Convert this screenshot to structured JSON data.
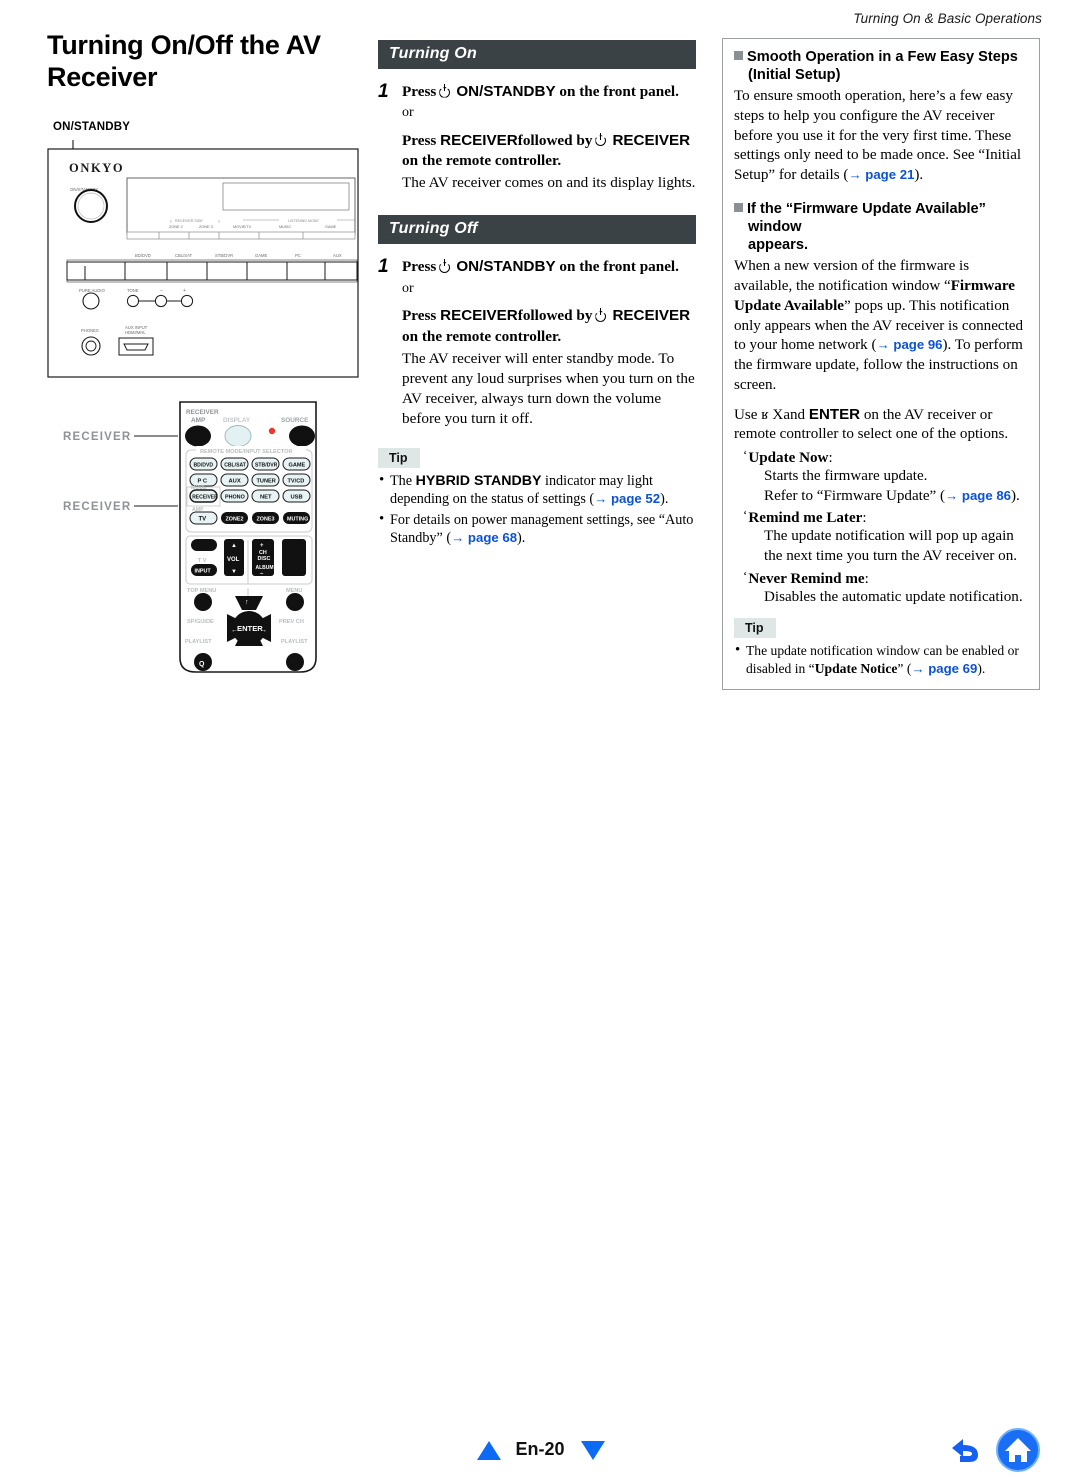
{
  "header": {
    "running_title": "Turning On & Basic Operations"
  },
  "left": {
    "chapter_title": "Turning On/Off the AV Receiver",
    "callout_onstandby": "ON/STANDBY",
    "receiver_figure": {
      "brand": "ONKYO",
      "power_label": "ON/STANDBY",
      "listening_mode_group": "LISTENING MODE",
      "listening_modes": [
        "MOVIE/TV",
        "MUSIC",
        "GAME"
      ],
      "zone_group": "RECEIVER SIDE",
      "zones": [
        "ZONE 2",
        "ZONE 3"
      ],
      "input_labels": [
        "BD/DVD",
        "CBL/SAT",
        "STB/DVR",
        "GAME",
        "PC",
        "AUX"
      ],
      "knob_labels": [
        "PURE AUDIO",
        "TONE",
        "–",
        "+"
      ],
      "jack_labels": [
        "PHONES",
        "AUX INPUT HDMI/MHL"
      ]
    },
    "remote_figure": {
      "callout_top": "RECEIVER",
      "callout_bottom": "RECEIVER",
      "top_labels": [
        "RECEIVER AMP",
        "DISPLAY",
        "SOURCE"
      ],
      "selector_group": "REMOTE MODE/INPUT SELECTOR",
      "selector_buttons": [
        "BD/DVD",
        "CBL/SAT",
        "STB/DVR",
        "GAME",
        "P C",
        "AUX",
        "TUNER",
        "TV/CD",
        "RECEIVER",
        "PHONO",
        "NET",
        "USB",
        "TV",
        "ZONE2",
        "ZONE3",
        "MUTING"
      ],
      "mode_label": "MODE",
      "amp_label": "AMP",
      "mid_labels": [
        "TV",
        "INPUT",
        "VOL",
        "+",
        "CH",
        "DISC",
        "ALBUM",
        "–"
      ],
      "lower_labels": [
        "TOP MENU",
        "MENU",
        "SP/GUIDE",
        "PREV CH",
        "PLAYLIST",
        "PLAYLIST",
        "ENTER",
        "Q"
      ]
    }
  },
  "middle": {
    "sections": [
      {
        "title": "Turning On",
        "step_number": "1",
        "step_line_1_pre": "Press",
        "step_line_1_bold": "ON/STANDBY",
        "step_line_1_post": "on the front panel.",
        "or": "or",
        "step_line_2_pre": "Press",
        "step_line_2_bold_a": "RECEIVER",
        "step_line_2_mid": "followed by",
        "step_line_2_bold_b": "RECEIVER",
        "step_line_2_post": "on the remote controller.",
        "description": "The AV receiver comes on and its display lights."
      },
      {
        "title": "Turning Off",
        "step_number": "1",
        "step_line_1_pre": "Press",
        "step_line_1_bold": "ON/STANDBY",
        "step_line_1_post": "on the front panel.",
        "or": "or",
        "step_line_2_pre": "Press",
        "step_line_2_bold_a": "RECEIVER",
        "step_line_2_mid": "followed by",
        "step_line_2_bold_b": "RECEIVER",
        "step_line_2_post": "on the remote controller.",
        "description": "The AV receiver will enter standby mode. To prevent any loud surprises when you turn on the AV receiver, always turn down the volume before you turn it off."
      }
    ],
    "tip": {
      "label": "Tip",
      "items": [
        {
          "pre": "The ",
          "bold": "HYBRID STANDBY",
          "mid": " indicator may light depending on the status of settings (",
          "ref": "→ page 52",
          "post": ")."
        },
        {
          "pre": "For details on power management settings, see “Auto Standby” (",
          "bold": "",
          "mid": "",
          "ref": "→ page 68",
          "post": ")."
        }
      ]
    }
  },
  "right": {
    "head1_line1": "Smooth Operation in a Few Easy Steps",
    "head1_line2": "(Initial Setup)",
    "para1_a": "To ensure smooth operation, here’s a few easy steps to help you configure the AV receiver before you use it for the very first time. These settings only need to be made once. See “Initial Setup” for details (",
    "para1_ref": "→ page 21",
    "para1_b": ").",
    "head2_line1": "If the “Firmware Update Available” window",
    "head2_line2": "appears.",
    "para2_a": "When a new version of the firmware is available, the notification window “",
    "para2_bold": "Firmware Update Available",
    "para2_b": "” pops up. This notification only appears when the AV receiver is connected to your home network (",
    "para2_ref": "→ page 96",
    "para2_c": "). To perform the firmware update, follow the instructions on screen.",
    "para3_a": "Use",
    "para3_glyph": "ʁ X",
    "para3_b": "and",
    "para3_bold": "ENTER",
    "para3_c": "on the AV receiver or remote controller to select one of the options.",
    "options": [
      {
        "term": "Update Now",
        "term_suffix": ":",
        "def_line1": "Starts the firmware update.",
        "def_line2_a": "Refer to “Firmware Update” (",
        "def_line2_ref": "→ page 86",
        "def_line2_b": ")."
      },
      {
        "term": "Remind me Later",
        "term_suffix": ":",
        "def_line1": "The update notification will pop up again the next time you turn the AV receiver on.",
        "def_line2_a": "",
        "def_line2_ref": "",
        "def_line2_b": ""
      },
      {
        "term": "Never Remind me",
        "term_suffix": ":",
        "def_line1": "Disables the automatic update notification.",
        "def_line2_a": "",
        "def_line2_ref": "",
        "def_line2_b": ""
      }
    ],
    "tip": {
      "label": "Tip",
      "item_pre": "The update notification window can be enabled or disabled in “",
      "item_bold": "Update Notice",
      "item_mid": "” (",
      "item_ref": "→ page 69",
      "item_post": ")."
    }
  },
  "footer": {
    "page_label": "En-20",
    "prev_icon": "triangle-up-icon",
    "next_icon": "triangle-down-icon",
    "back_icon": "back-arrow-icon",
    "home_icon": "home-icon"
  },
  "colors": {
    "section_bar": "#3b4246",
    "tip_bg": "#dfe6e6",
    "link": "#0b52d6",
    "nav_blue": "#0b6bf5",
    "box_border": "#9aa0a2"
  }
}
